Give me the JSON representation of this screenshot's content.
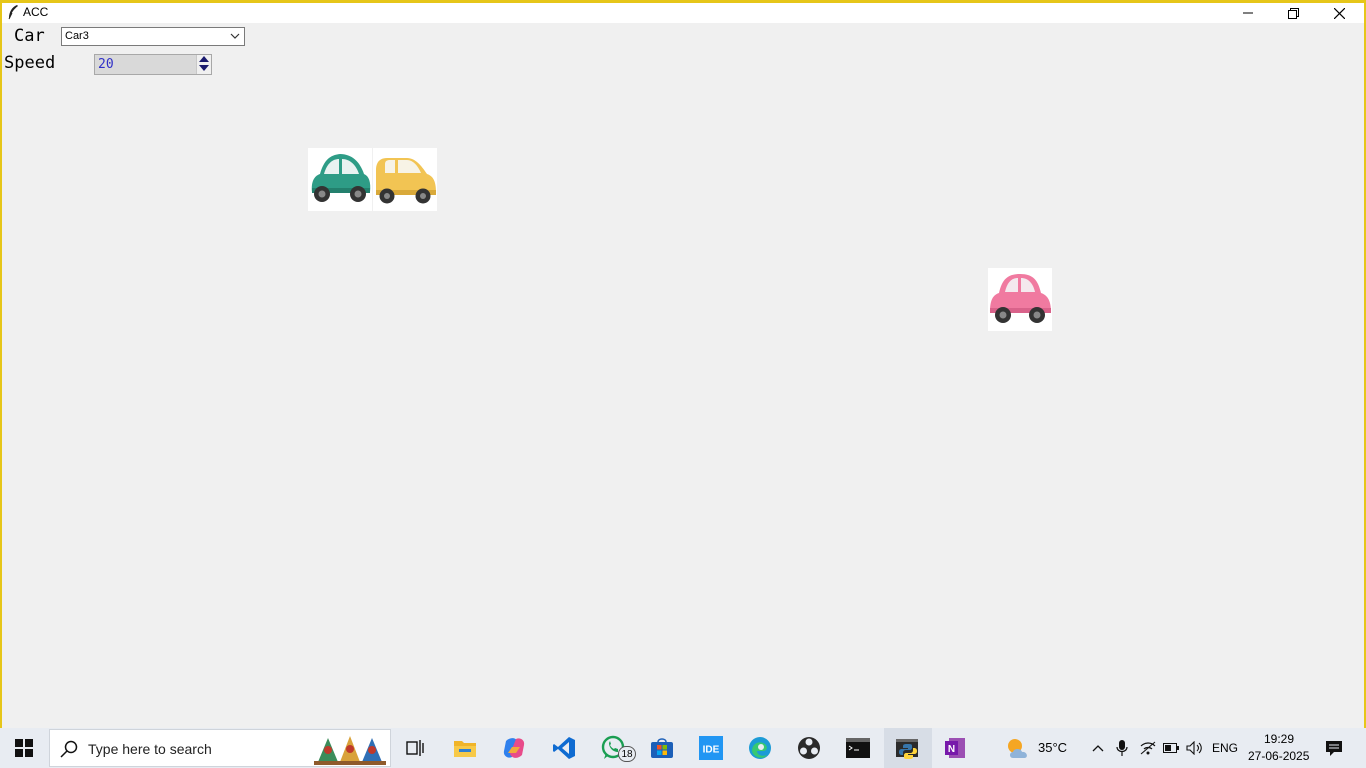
{
  "window": {
    "title": "ACC",
    "controls": [
      "minimize-icon",
      "restore-icon",
      "close-icon"
    ]
  },
  "form": {
    "car_label": "Car",
    "car_selected": "Car3",
    "speed_label": "Speed",
    "speed_value": "20"
  },
  "cars": [
    {
      "name": "green-car",
      "color": "#2e9c86"
    },
    {
      "name": "yellow-car",
      "color": "#f2c453"
    },
    {
      "name": "pink-car",
      "color": "#f07aa0"
    }
  ],
  "taskbar": {
    "search_placeholder": "Type here to search",
    "whatsapp_badge": "18",
    "weather_temp": "35°C",
    "language": "ENG",
    "time": "19:29",
    "date": "27-06-2025",
    "apps": [
      "task-view-icon",
      "file-explorer-icon",
      "copilot-icon",
      "vscode-icon",
      "whatsapp-icon",
      "store-icon",
      "ide-icon",
      "edge-icon",
      "obs-icon",
      "terminal-icon",
      "python-icon",
      "onenote-icon"
    ]
  },
  "colors": {
    "window_border": "#e6c619",
    "background": "#f0f0f0",
    "spin_text": "#3030c8"
  }
}
